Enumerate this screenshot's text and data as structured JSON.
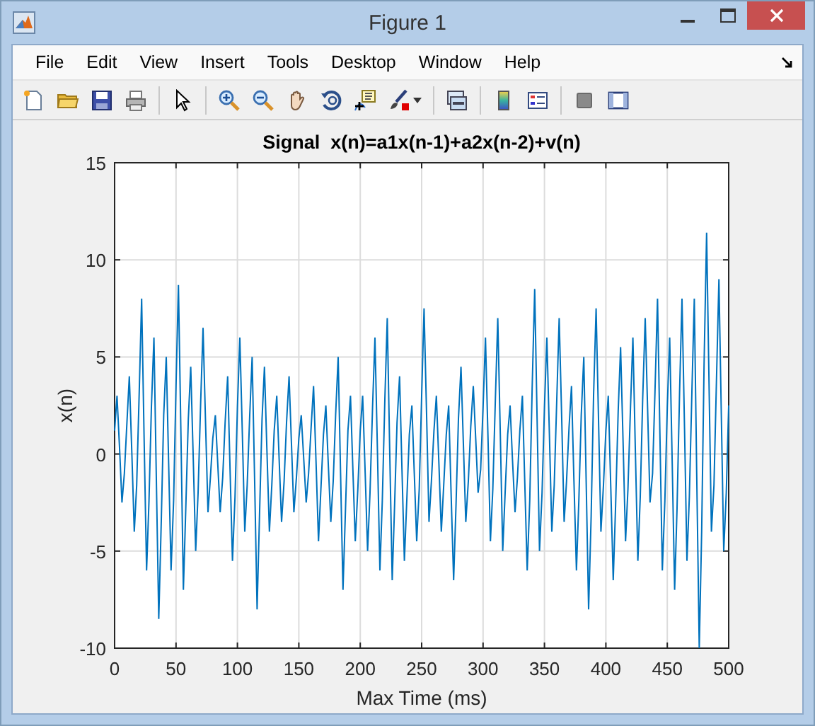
{
  "window": {
    "title": "Figure 1"
  },
  "menu": [
    "File",
    "Edit",
    "View",
    "Insert",
    "Tools",
    "Desktop",
    "Window",
    "Help"
  ],
  "figure": {
    "chart_data": {
      "type": "line",
      "title": "Signal  x(n)=a1x(n-1)+a2x(n-2)+v(n)",
      "xlabel": "Max Time (ms)",
      "ylabel": "x(n)",
      "xlim": [
        0,
        500
      ],
      "ylim": [
        -10,
        15
      ],
      "xticks": [
        0,
        50,
        100,
        150,
        200,
        250,
        300,
        350,
        400,
        450,
        500
      ],
      "yticks": [
        -10,
        -5,
        0,
        5,
        10,
        15
      ],
      "grid": true,
      "x": [
        0,
        2,
        4,
        6,
        8,
        10,
        12,
        14,
        16,
        18,
        20,
        22,
        24,
        26,
        28,
        30,
        32,
        34,
        36,
        38,
        40,
        42,
        44,
        46,
        48,
        50,
        52,
        54,
        56,
        58,
        60,
        62,
        64,
        66,
        68,
        70,
        72,
        74,
        76,
        78,
        80,
        82,
        84,
        86,
        88,
        90,
        92,
        94,
        96,
        98,
        100,
        102,
        104,
        106,
        108,
        110,
        112,
        114,
        116,
        118,
        120,
        122,
        124,
        126,
        128,
        130,
        132,
        134,
        136,
        138,
        140,
        142,
        144,
        146,
        148,
        150,
        152,
        154,
        156,
        158,
        160,
        162,
        164,
        166,
        168,
        170,
        172,
        174,
        176,
        178,
        180,
        182,
        184,
        186,
        188,
        190,
        192,
        194,
        196,
        198,
        200,
        202,
        204,
        206,
        208,
        210,
        212,
        214,
        216,
        218,
        220,
        222,
        224,
        226,
        228,
        230,
        232,
        234,
        236,
        238,
        240,
        242,
        244,
        246,
        248,
        250,
        252,
        254,
        256,
        258,
        260,
        262,
        264,
        266,
        268,
        270,
        272,
        274,
        276,
        278,
        280,
        282,
        284,
        286,
        288,
        290,
        292,
        294,
        296,
        298,
        300,
        302,
        304,
        306,
        308,
        310,
        312,
        314,
        316,
        318,
        320,
        322,
        324,
        326,
        328,
        330,
        332,
        334,
        336,
        338,
        340,
        342,
        344,
        346,
        348,
        350,
        352,
        354,
        356,
        358,
        360,
        362,
        364,
        366,
        368,
        370,
        372,
        374,
        376,
        378,
        380,
        382,
        384,
        386,
        388,
        390,
        392,
        394,
        396,
        398,
        400,
        402,
        404,
        406,
        408,
        410,
        412,
        414,
        416,
        418,
        420,
        422,
        424,
        426,
        428,
        430,
        432,
        434,
        436,
        438,
        440,
        442,
        444,
        446,
        448,
        450,
        452,
        454,
        456,
        458,
        460,
        462,
        464,
        466,
        468,
        470,
        472,
        474,
        476,
        478,
        480,
        482,
        484,
        486,
        488,
        490,
        492,
        494,
        496,
        498,
        500
      ],
      "series": [
        {
          "color": "#0072bd",
          "values": [
            1.2,
            3,
            0.3,
            -2.5,
            -1,
            1.6,
            4,
            0,
            -4,
            -1.6,
            3.2,
            8,
            1,
            -6,
            -2.4,
            2.4,
            6,
            -1.3,
            -8.5,
            -3.4,
            2,
            5,
            -0.5,
            -6,
            -2.4,
            3.5,
            8.7,
            0.9,
            -7,
            -2.8,
            1.8,
            4.5,
            -0.3,
            -5,
            -2,
            2.6,
            6.5,
            1.8,
            -3,
            -1.2,
            0.8,
            2,
            -0.5,
            -3,
            -1.2,
            1.6,
            4,
            -0.8,
            -5.5,
            -2.2,
            2.4,
            6,
            1,
            -4,
            -1.6,
            2,
            5,
            -1.5,
            -8,
            -3.2,
            1.8,
            4.5,
            0.3,
            -4,
            -1.6,
            1.2,
            3,
            -0.3,
            -3.5,
            -1.4,
            1.6,
            4,
            0.5,
            -3,
            -1.2,
            0.8,
            2,
            -0.3,
            -2.5,
            -1,
            1.4,
            3.5,
            -0.5,
            -4.5,
            -1.8,
            1,
            2.5,
            -0.5,
            -3.5,
            -1.4,
            2,
            5,
            -1,
            -7,
            -2.8,
            1.2,
            3,
            -0.8,
            -4.5,
            -1.8,
            1.2,
            3,
            -1,
            -5,
            -2,
            2.4,
            6,
            0,
            -6,
            -2.4,
            2.8,
            7,
            0.3,
            -6.5,
            -2.6,
            1.6,
            4,
            -0.8,
            -5.5,
            -2.2,
            1,
            2.5,
            -1,
            -4.5,
            -1.8,
            3,
            7.5,
            2,
            -3.5,
            -1.4,
            1.2,
            3,
            -0.5,
            -4,
            -1.6,
            1,
            2.5,
            -2,
            -6.5,
            -2.6,
            1.8,
            4.5,
            0.5,
            -3.5,
            -1.4,
            1.4,
            3.5,
            0.8,
            -2,
            -0.8,
            2.4,
            6,
            0.8,
            -4.5,
            -1.8,
            2.8,
            7,
            1,
            -5,
            -2,
            1,
            2.5,
            -0.3,
            -3,
            -1.2,
            1.2,
            3,
            -1.5,
            -6,
            -2.4,
            3.4,
            8.5,
            1.8,
            -5,
            -2,
            2.4,
            6,
            1,
            -4,
            -1.6,
            2.8,
            7,
            1.8,
            -3.5,
            -1.4,
            1.4,
            3.5,
            -1.3,
            -6,
            -2.4,
            2,
            5,
            -1.5,
            -8,
            -3.2,
            3,
            7.5,
            1.8,
            -4,
            -1.6,
            1.2,
            3,
            -1.8,
            -6.5,
            -2.6,
            2.2,
            5.5,
            0.5,
            -4.5,
            -1.8,
            2.4,
            6,
            0.3,
            -5.5,
            -2.2,
            2.8,
            7,
            2.3,
            -2.5,
            -1,
            3.2,
            8,
            1,
            -6,
            -2.4,
            2.4,
            6,
            -0.5,
            -7,
            -2.8,
            3.2,
            8,
            1.3,
            -5.5,
            -2.2,
            3.2,
            8,
            -1,
            -10,
            -4,
            4.6,
            11.4,
            3.7,
            -4,
            -1.6,
            3.6,
            9,
            2,
            -5,
            -2,
            2.5
          ]
        }
      ]
    }
  }
}
